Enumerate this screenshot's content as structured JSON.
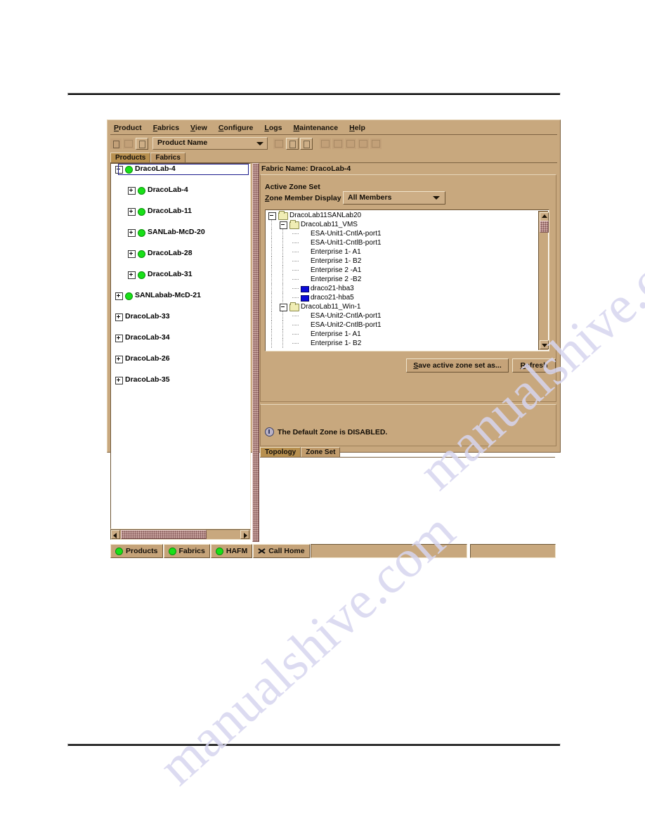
{
  "window": {
    "menus": [
      {
        "label": "Product",
        "mnemonic": "P"
      },
      {
        "label": "Fabrics",
        "mnemonic": "F"
      },
      {
        "label": "View",
        "mnemonic": "V"
      },
      {
        "label": "Configure",
        "mnemonic": "C"
      },
      {
        "label": "Logs",
        "mnemonic": "L"
      },
      {
        "label": "Maintenance",
        "mnemonic": "M"
      },
      {
        "label": "Help",
        "mnemonic": "H"
      }
    ]
  },
  "toolbar": {
    "icons_left": [
      "new-product-icon",
      "open-folder-icon",
      "open-product-icon"
    ],
    "combo_value": "Product Name",
    "icons_right": [
      "save-icon",
      "fabric-icon",
      "book-icon",
      "topology-icon",
      "zoom-icon",
      "zoom-in-icon",
      "zoom-out-icon",
      "fit-icon"
    ]
  },
  "top_tabs": {
    "items": [
      {
        "label": "Products",
        "selected": true
      },
      {
        "label": "Fabrics",
        "selected": false
      }
    ]
  },
  "product_tree": {
    "nodes": [
      {
        "label": "DracoLab-4",
        "depth": 0,
        "expander": "minus",
        "status": "green",
        "selected": true
      },
      {
        "label": "DracoLab-4",
        "depth": 1,
        "expander": "plus",
        "status": "green",
        "selected": false
      },
      {
        "label": "DracoLab-11",
        "depth": 1,
        "expander": "plus",
        "status": "green",
        "selected": false
      },
      {
        "label": "SANLab-McD-20",
        "depth": 1,
        "expander": "plus",
        "status": "green",
        "selected": false
      },
      {
        "label": "DracoLab-28",
        "depth": 1,
        "expander": "plus",
        "status": "green",
        "selected": false
      },
      {
        "label": "DracoLab-31",
        "depth": 1,
        "expander": "plus",
        "status": "green",
        "selected": false
      },
      {
        "label": "SANLabab-McD-21",
        "depth": 0,
        "expander": "plus",
        "status": "green",
        "selected": false
      },
      {
        "label": "DracoLab-33",
        "depth": 0,
        "expander": "plus",
        "status": "none",
        "selected": false
      },
      {
        "label": "DracoLab-34",
        "depth": 0,
        "expander": "plus",
        "status": "none",
        "selected": false
      },
      {
        "label": "DracoLab-26",
        "depth": 0,
        "expander": "plus",
        "status": "none",
        "selected": false
      },
      {
        "label": "DracoLab-35",
        "depth": 0,
        "expander": "plus",
        "status": "none",
        "selected": false
      }
    ]
  },
  "fabric": {
    "name_label": "Fabric Name: DracoLab-4",
    "group_legend": "Active Zone Set",
    "zone_member_display_label": "Zone Member Display",
    "zone_member_display_value": "All Members"
  },
  "zone_tree": {
    "nodes": [
      {
        "label": "DracoLab11SANLab20",
        "depth": 0,
        "icon": "folder",
        "expander": "minus"
      },
      {
        "label": "DracoLab11_VMS",
        "depth": 1,
        "icon": "folder",
        "expander": "minus"
      },
      {
        "label": "ESA-Unit1-CntlA-port1",
        "depth": 2,
        "icon": "leaf",
        "expander": "none"
      },
      {
        "label": "ESA-Unit1-CntlB-port1",
        "depth": 2,
        "icon": "leaf",
        "expander": "none"
      },
      {
        "label": "Enterprise 1- A1",
        "depth": 2,
        "icon": "leaf",
        "expander": "none"
      },
      {
        "label": "Enterprise 1- B2",
        "depth": 2,
        "icon": "leaf",
        "expander": "none"
      },
      {
        "label": "Enterprise 2 -A1",
        "depth": 2,
        "icon": "leaf",
        "expander": "none"
      },
      {
        "label": "Enterprise 2 -B2",
        "depth": 2,
        "icon": "leaf",
        "expander": "none"
      },
      {
        "label": "draco21-hba3",
        "depth": 2,
        "icon": "hba",
        "expander": "none"
      },
      {
        "label": "draco21-hba5",
        "depth": 2,
        "icon": "hba",
        "expander": "none"
      },
      {
        "label": "DracoLab11_Win-1",
        "depth": 1,
        "icon": "folder",
        "expander": "minus"
      },
      {
        "label": "ESA-Unit2-CntlA-port1",
        "depth": 2,
        "icon": "leaf",
        "expander": "none"
      },
      {
        "label": "ESA-Unit2-CntlB-port1",
        "depth": 2,
        "icon": "leaf",
        "expander": "none"
      },
      {
        "label": "Enterprise 1- A1",
        "depth": 2,
        "icon": "leaf",
        "expander": "none"
      },
      {
        "label": "Enterprise 1- B2",
        "depth": 2,
        "icon": "leaf",
        "expander": "none"
      }
    ]
  },
  "buttons": {
    "save_prefix": "S",
    "save_rest": "ave active zone set as...",
    "refresh_prefix": "R",
    "refresh_rest": "efresh"
  },
  "status": {
    "message": "The Default Zone is DISABLED.",
    "icon": "info-icon"
  },
  "bottom_tabs": {
    "items": [
      {
        "label": "Topology",
        "selected": true
      },
      {
        "label": "Zone Set",
        "selected": false
      }
    ]
  },
  "statusbar": {
    "cells": [
      {
        "label": "Products",
        "icon": "green-dot"
      },
      {
        "label": "Fabrics",
        "icon": "green-dot"
      },
      {
        "label": "HAFM",
        "icon": "green-dot"
      },
      {
        "label": "Call Home",
        "icon": "x-mark"
      }
    ]
  },
  "watermark": {
    "line1": "manualshive.com",
    "line2": "manualshive.com"
  },
  "colors": {
    "window_background": "#c8a87e",
    "status_green": "#18e018",
    "hba_blue": "#0b0bd8",
    "folder_yellow": "#f0edb4",
    "selection_border": "#1a1a8c"
  }
}
